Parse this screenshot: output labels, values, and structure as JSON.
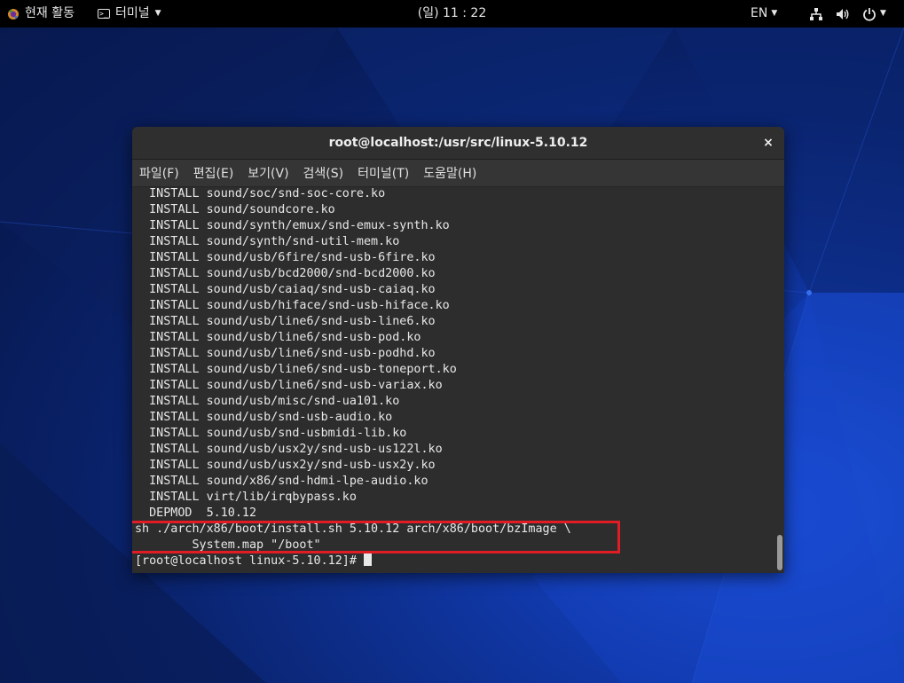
{
  "topbar": {
    "activities_label": "현재 활동",
    "app_menu_label": "터미널",
    "clock": "(일) 11 : 22",
    "input_language": "EN"
  },
  "window": {
    "title": "root@localhost:/usr/src/linux-5.10.12",
    "close_symbol": "×"
  },
  "menubar": {
    "items": [
      "파일(F)",
      "편집(E)",
      "보기(V)",
      "검색(S)",
      "터미널(T)",
      "도움말(H)"
    ]
  },
  "terminal": {
    "lines": [
      "  INSTALL sound/soc/snd-soc-core.ko",
      "  INSTALL sound/soundcore.ko",
      "  INSTALL sound/synth/emux/snd-emux-synth.ko",
      "  INSTALL sound/synth/snd-util-mem.ko",
      "  INSTALL sound/usb/6fire/snd-usb-6fire.ko",
      "  INSTALL sound/usb/bcd2000/snd-bcd2000.ko",
      "  INSTALL sound/usb/caiaq/snd-usb-caiaq.ko",
      "  INSTALL sound/usb/hiface/snd-usb-hiface.ko",
      "  INSTALL sound/usb/line6/snd-usb-line6.ko",
      "  INSTALL sound/usb/line6/snd-usb-pod.ko",
      "  INSTALL sound/usb/line6/snd-usb-podhd.ko",
      "  INSTALL sound/usb/line6/snd-usb-toneport.ko",
      "  INSTALL sound/usb/line6/snd-usb-variax.ko",
      "  INSTALL sound/usb/misc/snd-ua101.ko",
      "  INSTALL sound/usb/snd-usb-audio.ko",
      "  INSTALL sound/usb/snd-usbmidi-lib.ko",
      "  INSTALL sound/usb/usx2y/snd-usb-us122l.ko",
      "  INSTALL sound/usb/usx2y/snd-usb-usx2y.ko",
      "  INSTALL sound/x86/snd-hdmi-lpe-audio.ko",
      "  INSTALL virt/lib/irqbypass.ko",
      "  DEPMOD  5.10.12",
      "sh ./arch/x86/boot/install.sh 5.10.12 arch/x86/boot/bzImage \\",
      "        System.map \"/boot\""
    ],
    "prompt": "[root@localhost linux-5.10.12]# "
  },
  "colors": {
    "highlight_border": "#e01c24",
    "terminal_bg": "#2d2d2d",
    "terminal_fg": "#e8e8e8"
  },
  "icons": {
    "activities": "gnome-foot-icon",
    "app_menu": "terminal-icon",
    "network": "network-wired-icon",
    "volume": "volume-icon",
    "power": "power-icon"
  }
}
